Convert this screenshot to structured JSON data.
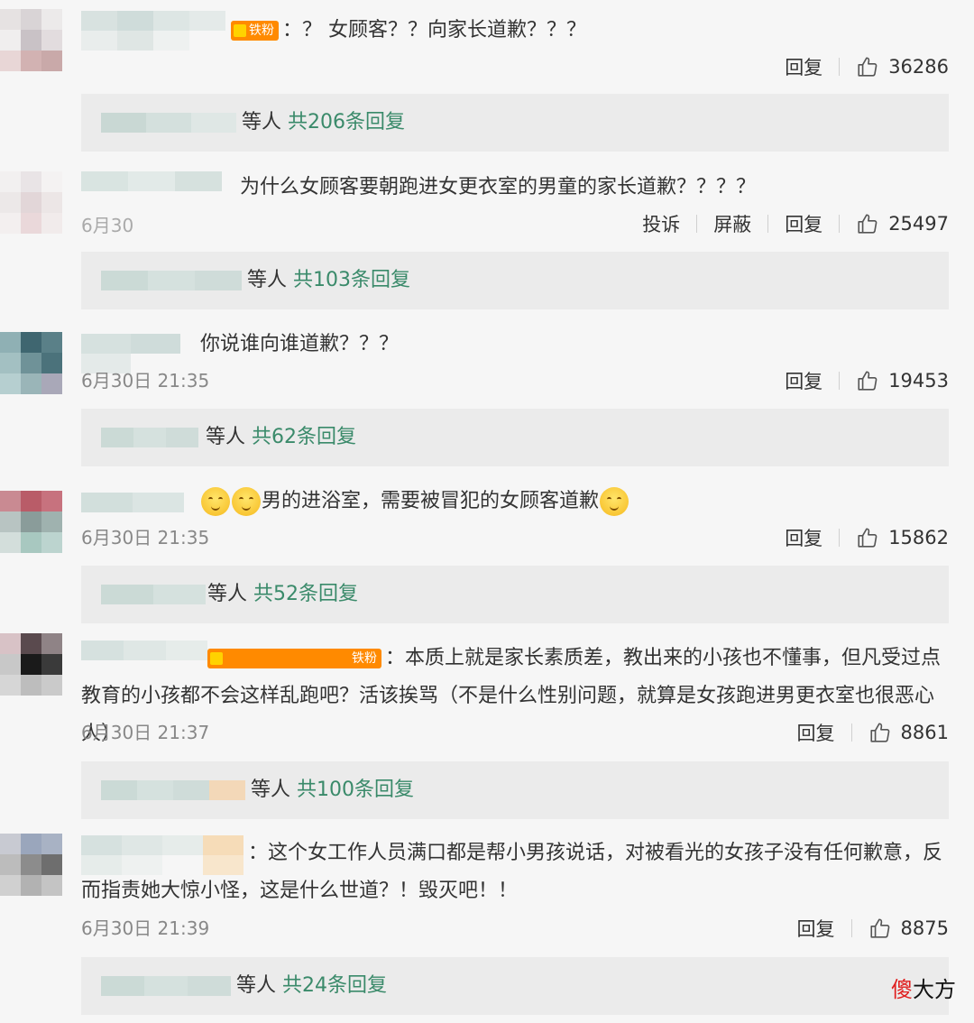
{
  "badge": {
    "label": "铁粉"
  },
  "comments": [
    {
      "text": "：？ 女顾客？？向家长道歉？？？",
      "time": "",
      "actions": [
        "回复"
      ],
      "likes": "36286",
      "reply_suffix": "等人",
      "reply_count": "共206条回复"
    },
    {
      "text": "为什么女顾客要朝跑进女更衣室的男童的家长道歉？？？？",
      "time": "6月30",
      "actions": [
        "投诉",
        "屏蔽",
        "回复"
      ],
      "likes": "25497",
      "reply_suffix": "等人",
      "reply_count": "共103条回复"
    },
    {
      "text": "你说谁向谁道歉？？？",
      "time": "6月30日 21:35",
      "actions": [
        "回复"
      ],
      "likes": "19453",
      "reply_suffix": "等人",
      "reply_count": "共62条回复"
    },
    {
      "text": "男的进浴室，需要被冒犯的女顾客道歉",
      "time": "6月30日 21:35",
      "actions": [
        "回复"
      ],
      "likes": "15862",
      "reply_suffix": "等人",
      "reply_count": "共52条回复"
    },
    {
      "text": "：本质上就是家长素质差，教出来的小孩也不懂事，但凡受过点教育的小孩都不会这样乱跑吧？活该挨骂（不是什么性别问题，就算是女孩跑进男更衣室也很恶心人）",
      "time": "6月30日 21:37",
      "actions": [
        "回复"
      ],
      "likes": "8861",
      "reply_suffix": "等人",
      "reply_count": "共100条回复"
    },
    {
      "text": "：这个女工作人员满口都是帮小男孩说话，对被看光的女孩子没有任何歉意，反而指责她大惊小怪，这是什么世道？！毁灭吧！！",
      "time": "6月30日 21:39",
      "actions": [
        "回复"
      ],
      "likes": "8875",
      "reply_suffix": "等人",
      "reply_count": "共24条回复"
    }
  ],
  "watermark": {
    "part1": "傻",
    "part2": "大方"
  },
  "colors": {
    "accent": "#3a8a6a",
    "badge": "#ff8a00",
    "background": "#f6f6f6",
    "reply_box": "#ebebeb"
  },
  "icons": {
    "like": "thumbs-up-icon",
    "emoji": "smiling-face-icon"
  }
}
